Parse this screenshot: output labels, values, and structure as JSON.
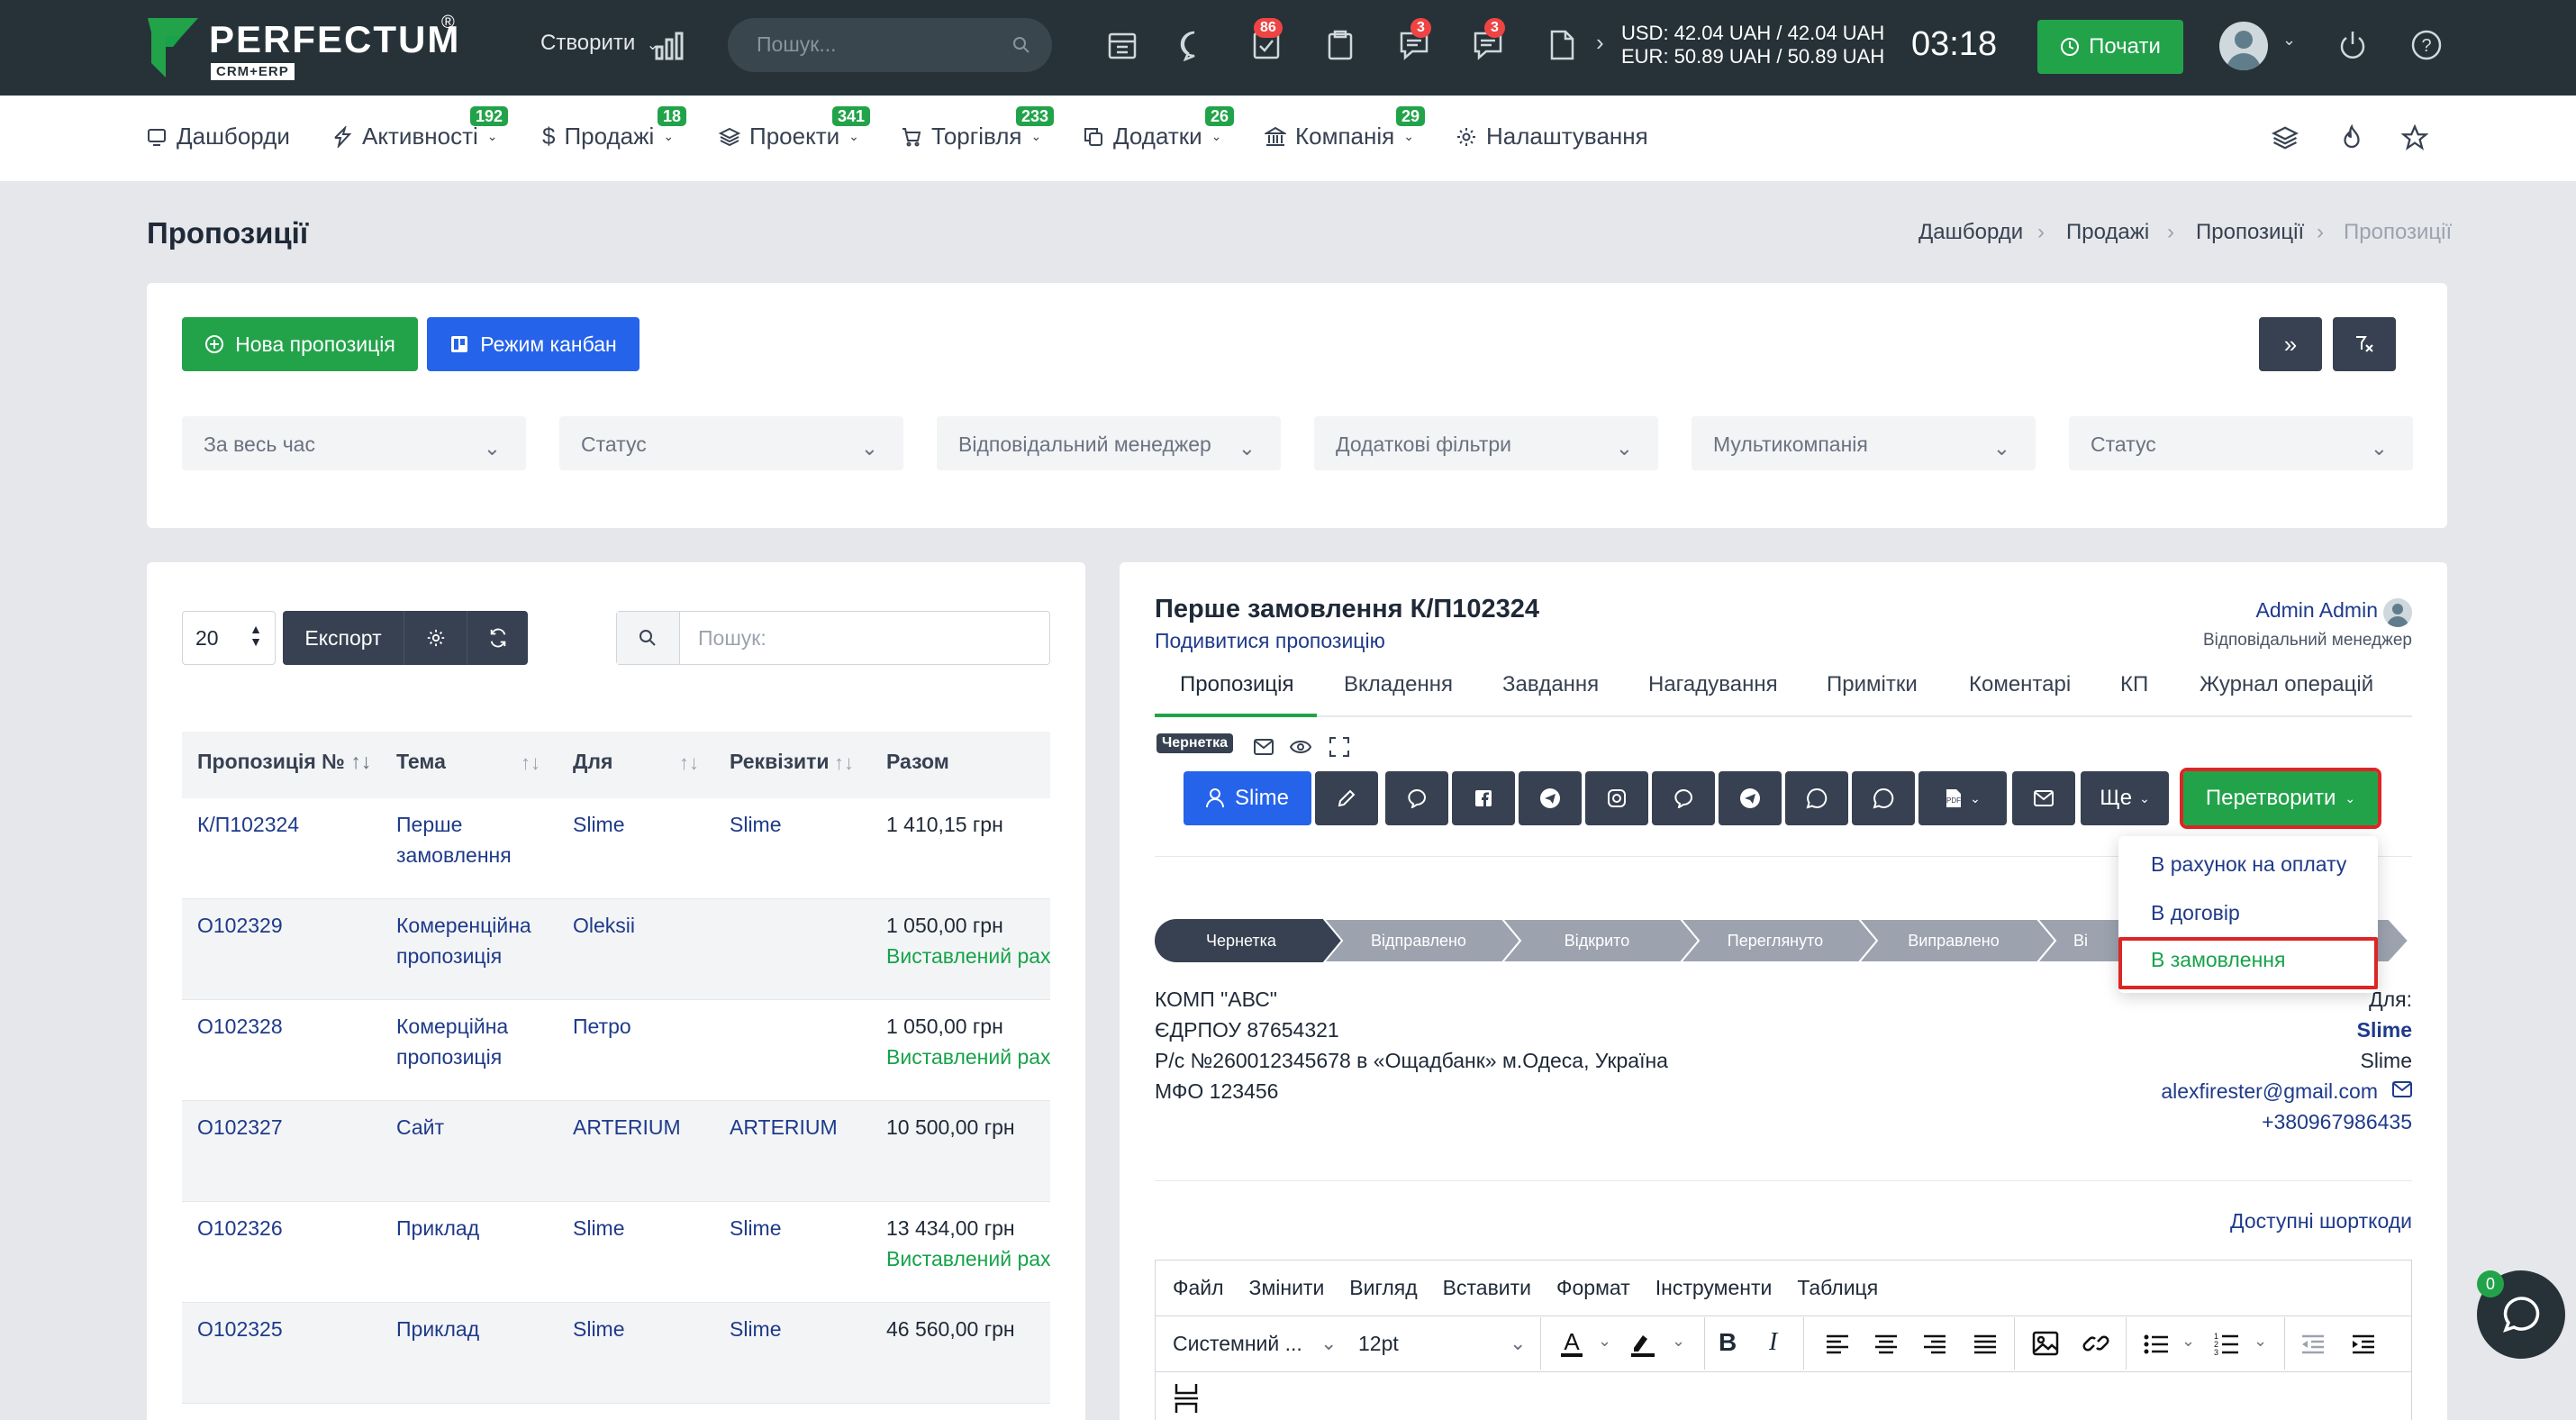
{
  "brand": {
    "name": "PERFECTUM",
    "sub": "CRM+ERP",
    "reg": "®"
  },
  "topbar": {
    "create_label": "Створити",
    "search_placeholder": "Пошук...",
    "badges": {
      "tasks": "86",
      "chat": "3",
      "messages": "3"
    },
    "currency_usd": "USD: 42.04 UAH / 42.04 UAH",
    "currency_eur": "EUR: 50.89 UAH / 50.89 UAH",
    "clock": "03:18",
    "start_label": "Почати"
  },
  "nav": {
    "items": [
      {
        "label": "Дашборди",
        "badge": ""
      },
      {
        "label": "Активності",
        "badge": "192"
      },
      {
        "label": "Продажі",
        "badge": "18"
      },
      {
        "label": "Проекти",
        "badge": "341"
      },
      {
        "label": "Торгівля",
        "badge": "233"
      },
      {
        "label": "Додатки",
        "badge": "26"
      },
      {
        "label": "Компанія",
        "badge": "29"
      },
      {
        "label": "Налаштування",
        "badge": ""
      }
    ]
  },
  "page": {
    "title": "Пропозиції",
    "breadcrumb": [
      "Дашборди",
      "Продажі",
      "Пропозиції",
      "Пропозиції"
    ]
  },
  "actions": {
    "new_label": "Нова пропозиція",
    "kanban_label": "Режим канбан"
  },
  "filters": [
    "За весь час",
    "Статус",
    "Відповідальний менеджер",
    "Додаткові фільтри",
    "Мультикомпанія",
    "Статус"
  ],
  "list": {
    "page_size": "20",
    "export_label": "Експорт",
    "search_placeholder": "Пошук:",
    "columns": [
      "Пропозиція №",
      "Тема",
      "Для",
      "Реквізити",
      "Разом"
    ],
    "rows": [
      {
        "id": "К/П102324",
        "subject": "Перше замовлення",
        "for": "Slime",
        "details": "Slime",
        "total": "1 410,15 грн",
        "status": ""
      },
      {
        "id": "O102329",
        "subject": "Комеренційна пропозиція",
        "for": "Oleksii",
        "details": "",
        "total": "1 050,00 грн",
        "status": "Виставлений рах"
      },
      {
        "id": "O102328",
        "subject": "Комерційна пропозиція",
        "for": "Петро",
        "details": "",
        "total": "1 050,00 грн",
        "status": "Виставлений рах"
      },
      {
        "id": "O102327",
        "subject": "Сайт",
        "for": "ARTERIUM",
        "details": "ARTERIUM",
        "total": "10 500,00 грн",
        "status": ""
      },
      {
        "id": "O102326",
        "subject": "Приклад",
        "for": "Slime",
        "details": "Slime",
        "total": "13 434,00 грн",
        "status": "Виставлений рах"
      },
      {
        "id": "O102325",
        "subject": "Приклад",
        "for": "Slime",
        "details": "Slime",
        "total": "46 560,00 грн",
        "status": ""
      }
    ]
  },
  "detail": {
    "title": "Перше замовлення К/П102324",
    "view_link": "Подивитися пропозицію",
    "manager_name": "Admin Admin",
    "manager_role": "Відповідальний менеджер",
    "tabs": [
      "Пропозиція",
      "Вкладення",
      "Завдання",
      "Нагадування",
      "Примітки",
      "Коментарі",
      "КП",
      "Журнал операцій"
    ],
    "draft_badge": "Чернетка",
    "client_button": "Slime",
    "more_label": "Ще",
    "convert_label": "Перетворити",
    "convert_menu": [
      "В рахунок на оплату",
      "В договір",
      "В замовлення"
    ],
    "stages": [
      "Чернетка",
      "Відправлено",
      "Відкрито",
      "Переглянуто",
      "Виправлено",
      "Ві"
    ],
    "company_lines": [
      "КОМП \"АВС\"",
      "ЄДРПОУ 87654321",
      "Р/с №260012345678 в «Ощадбанк» м.Одеса, Україна",
      "МФО 123456"
    ],
    "for_label": "Для:",
    "client_name": "Slime",
    "client_sub": "Slime",
    "client_email": "alexfirester@gmail.com",
    "client_phone": "+380967986435",
    "shortcodes": "Доступні шорткоди",
    "editor_menu": [
      "Файл",
      "Змінити",
      "Вигляд",
      "Вставити",
      "Формат",
      "Інструменти",
      "Таблиця"
    ],
    "font_family": "Системний ...",
    "font_size": "12pt"
  },
  "chat_badge": "0",
  "colors": {
    "topbar": "#263238",
    "green": "#22a34a",
    "blue": "#2563eb",
    "dark_btn": "#374151",
    "highlight": "#dc2626"
  }
}
